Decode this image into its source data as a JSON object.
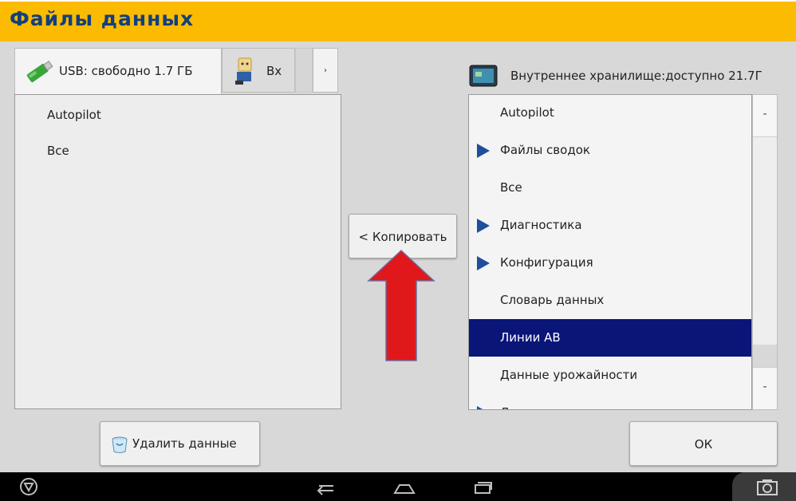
{
  "app": {
    "title": "Файлы данных"
  },
  "left_panel": {
    "tabs": [
      {
        "label": "USB: свободно 1.7 ГБ",
        "icon": "usb-drive-icon"
      },
      {
        "label": "Вх",
        "icon": "person-device-icon"
      }
    ],
    "more_tabs": "›",
    "items": [
      "Autopilot",
      "Все"
    ]
  },
  "copy_button": {
    "label": "< Копировать"
  },
  "annotation": {
    "arrow": "red-up-arrow",
    "color": "#e0181c"
  },
  "right_panel": {
    "header": "Внутреннее хранилище:доступно 21.7Г",
    "header_icon": "tablet-icon",
    "items": [
      {
        "label": "Autopilot",
        "expandable": false,
        "selected": false
      },
      {
        "label": "Файлы сводок",
        "expandable": true,
        "selected": false
      },
      {
        "label": "Все",
        "expandable": false,
        "selected": false
      },
      {
        "label": "Диагностика",
        "expandable": true,
        "selected": false
      },
      {
        "label": "Конфигурация",
        "expandable": true,
        "selected": false
      },
      {
        "label": "Словарь данных",
        "expandable": false,
        "selected": false
      },
      {
        "label": "Линии АВ",
        "expandable": false,
        "selected": true
      },
      {
        "label": "Данные урожайности",
        "expandable": false,
        "selected": false
      },
      {
        "label": "Данные поля",
        "expandable": true,
        "selected": false
      }
    ],
    "scroll_up": "-",
    "scroll_down": "-"
  },
  "bottom": {
    "delete_label": "Удалить данные",
    "ok_label": "ОК"
  },
  "colors": {
    "title_bar": "#fbbb00",
    "title_text": "#123f7e",
    "selection": "#0a1578",
    "expand_triangle": "#1d4f9c"
  },
  "system_nav": {
    "icons": [
      "triangle-logo-icon",
      "back-icon",
      "home-icon",
      "recents-icon",
      "camera-icon"
    ]
  }
}
